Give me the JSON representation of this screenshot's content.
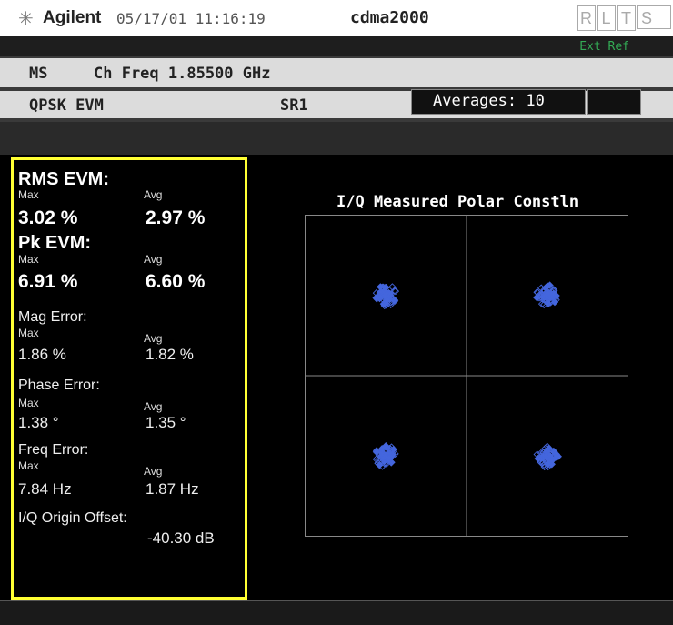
{
  "header": {
    "brand": "Agilent",
    "datetime": "05/17/01 11:16:19",
    "mode": "cdma2000",
    "indicators": [
      "R",
      "L",
      "T",
      "S"
    ],
    "logo_icon": "starburst-icon"
  },
  "status": {
    "ext_ref": "Ext Ref"
  },
  "params": {
    "ms": "MS",
    "ch_freq": "Ch Freq 1.85500 GHz",
    "measurement": "QPSK EVM",
    "sr": "SR1",
    "averages": "Averages: 10"
  },
  "results": {
    "rms_evm": {
      "label": "RMS EVM:",
      "max_label": "Max",
      "avg_label": "Avg",
      "max": "3.02 %",
      "avg": "2.97 %"
    },
    "pk_evm": {
      "label": "Pk EVM:",
      "max_label": "Max",
      "avg_label": "Avg",
      "max": "6.91 %",
      "avg": "6.60 %"
    },
    "mag_error": {
      "label": "Mag Error:",
      "max_label": "Max",
      "avg_label": "Avg",
      "max": "1.86 %",
      "avg": "1.82 %"
    },
    "phase_error": {
      "label": "Phase Error:",
      "max_label": "Max",
      "avg_label": "Avg",
      "max": "1.38 °",
      "avg": "1.35 °"
    },
    "freq_error": {
      "label": "Freq Error:",
      "max_label": "Max",
      "avg_label": "Avg",
      "max": "7.84 Hz",
      "avg": "1.87 Hz"
    },
    "iq_origin_offset": {
      "label": "I/Q Origin Offset:",
      "value": "-40.30 dB"
    }
  },
  "plot": {
    "title": "I/Q Measured Polar Constln",
    "point_color": "#4466dd",
    "grid_color": "#888888"
  },
  "chart_data": {
    "type": "scatter",
    "title": "I/Q Measured Polar Constln",
    "xlabel": "",
    "ylabel": "",
    "xlim": [
      -1,
      1
    ],
    "ylim": [
      -1,
      1
    ],
    "grid": true,
    "series": [
      {
        "values": [
          [
            -0.5,
            0.5
          ],
          [
            0.5,
            0.5
          ],
          [
            -0.5,
            -0.5
          ],
          [
            0.5,
            -0.5
          ]
        ]
      }
    ]
  },
  "colors": {
    "highlight_border": "#ffff33",
    "ext_ref": "#33aa55"
  }
}
